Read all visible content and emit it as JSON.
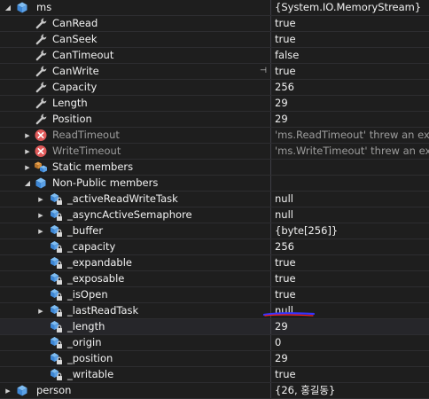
{
  "colors": {
    "background": "#1e1e1e",
    "text": "#f1f1f1",
    "error_text": "#9d9d9d",
    "property_icon": "#c8c8c8",
    "object_icon": "#5aa0e6",
    "error_icon": "#e05a5a",
    "annotation_underline": "#3333ff",
    "annotation_underline_red": "#ff2020"
  },
  "watch": {
    "rows": [
      {
        "name": "ms",
        "value": "{System.IO.MemoryStream}",
        "level": 0,
        "expander": "expanded",
        "icon": "object-icon"
      },
      {
        "name": "CanRead",
        "value": "true",
        "level": 1,
        "expander": "none",
        "icon": "wrench-icon"
      },
      {
        "name": "CanSeek",
        "value": "true",
        "level": 1,
        "expander": "none",
        "icon": "wrench-icon"
      },
      {
        "name": "CanTimeout",
        "value": "false",
        "level": 1,
        "expander": "none",
        "icon": "wrench-icon"
      },
      {
        "name": "CanWrite",
        "value": "true",
        "level": 1,
        "expander": "none",
        "icon": "wrench-icon",
        "pin": "⊣"
      },
      {
        "name": "Capacity",
        "value": "256",
        "level": 1,
        "expander": "none",
        "icon": "wrench-icon"
      },
      {
        "name": "Length",
        "value": "29",
        "level": 1,
        "expander": "none",
        "icon": "wrench-icon"
      },
      {
        "name": "Position",
        "value": "29",
        "level": 1,
        "expander": "none",
        "icon": "wrench-icon"
      },
      {
        "name": "ReadTimeout",
        "value": "'ms.ReadTimeout' threw an exception",
        "level": 1,
        "expander": "collapsed",
        "icon": "error-icon",
        "error": true
      },
      {
        "name": "WriteTimeout",
        "value": "'ms.WriteTimeout' threw an exception",
        "level": 1,
        "expander": "collapsed",
        "icon": "error-icon",
        "error": true
      },
      {
        "name": "Static members",
        "value": "",
        "level": 1,
        "expander": "collapsed",
        "icon": "static-members-icon"
      },
      {
        "name": "Non-Public members",
        "value": "",
        "level": 1,
        "expander": "expanded",
        "icon": "object-icon"
      },
      {
        "name": "_activeReadWriteTask",
        "value": "null",
        "level": 2,
        "expander": "collapsed",
        "icon": "private-field-icon"
      },
      {
        "name": "_asyncActiveSemaphore",
        "value": "null",
        "level": 2,
        "expander": "collapsed",
        "icon": "private-field-icon"
      },
      {
        "name": "_buffer",
        "value": "{byte[256]}",
        "level": 2,
        "expander": "collapsed",
        "icon": "private-field-icon"
      },
      {
        "name": "_capacity",
        "value": "256",
        "level": 2,
        "expander": "none",
        "icon": "private-field-icon"
      },
      {
        "name": "_expandable",
        "value": "true",
        "level": 2,
        "expander": "none",
        "icon": "private-field-icon"
      },
      {
        "name": "_exposable",
        "value": "true",
        "level": 2,
        "expander": "none",
        "icon": "private-field-icon"
      },
      {
        "name": "_isOpen",
        "value": "true",
        "level": 2,
        "expander": "none",
        "icon": "private-field-icon"
      },
      {
        "name": "_lastReadTask",
        "value": "null",
        "level": 2,
        "expander": "collapsed",
        "icon": "private-field-icon"
      },
      {
        "name": "_length",
        "value": "29",
        "level": 2,
        "expander": "none",
        "icon": "private-field-icon",
        "selected": true
      },
      {
        "name": "_origin",
        "value": "0",
        "level": 2,
        "expander": "none",
        "icon": "private-field-icon"
      },
      {
        "name": "_position",
        "value": "29",
        "level": 2,
        "expander": "none",
        "icon": "private-field-icon"
      },
      {
        "name": "_writable",
        "value": "true",
        "level": 2,
        "expander": "none",
        "icon": "private-field-icon"
      },
      {
        "name": "person",
        "value": "{26, 홍길동}",
        "level": 0,
        "expander": "collapsed",
        "icon": "object-icon"
      }
    ]
  }
}
